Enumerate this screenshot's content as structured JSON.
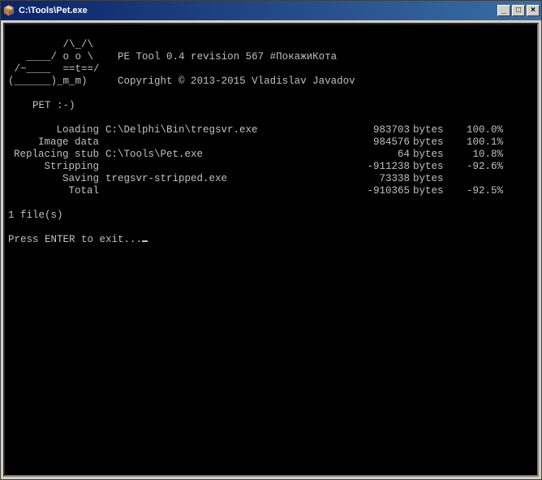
{
  "titlebar": {
    "title": "C:\\Tools\\Pet.exe",
    "icon_glyph": "📦",
    "min_label": "_",
    "max_label": "□",
    "close_label": "×"
  },
  "ascii_art": [
    "         /\\_/\\",
    "   ____/ o o \\",
    " /~____  ==t==/",
    "(______)_m_m)"
  ],
  "header": {
    "tool_line": "PE Tool 0.4 revision 567 #ПокажиКота",
    "blank": "",
    "copyright": "Copyright © 2013-2015 Vladislav Javadov"
  },
  "pet_emoji": "    PET :-)",
  "rows": [
    {
      "label": "Loading",
      "path": "C:\\Delphi\\Bin\\tregsvr.exe",
      "bytes": "983703",
      "btxt": "bytes",
      "pct": "100.0%"
    },
    {
      "label": "Image data",
      "path": "",
      "bytes": "984576",
      "btxt": "bytes",
      "pct": "100.1%"
    },
    {
      "label": "Replacing stub",
      "path": "C:\\Tools\\Pet.exe",
      "bytes": "64",
      "btxt": "bytes",
      "pct": "10.8%"
    },
    {
      "label": "Stripping",
      "path": "",
      "bytes": "-911238",
      "btxt": "bytes",
      "pct": "-92.6%"
    },
    {
      "label": "Saving",
      "path": "tregsvr-stripped.exe",
      "bytes": "73338",
      "btxt": "bytes",
      "pct": ""
    },
    {
      "label": "Total",
      "path": "",
      "bytes": "-910365",
      "btxt": "bytes",
      "pct": "-92.5%"
    }
  ],
  "file_count": "1 file(s)",
  "exit_prompt": "Press ENTER to exit..."
}
